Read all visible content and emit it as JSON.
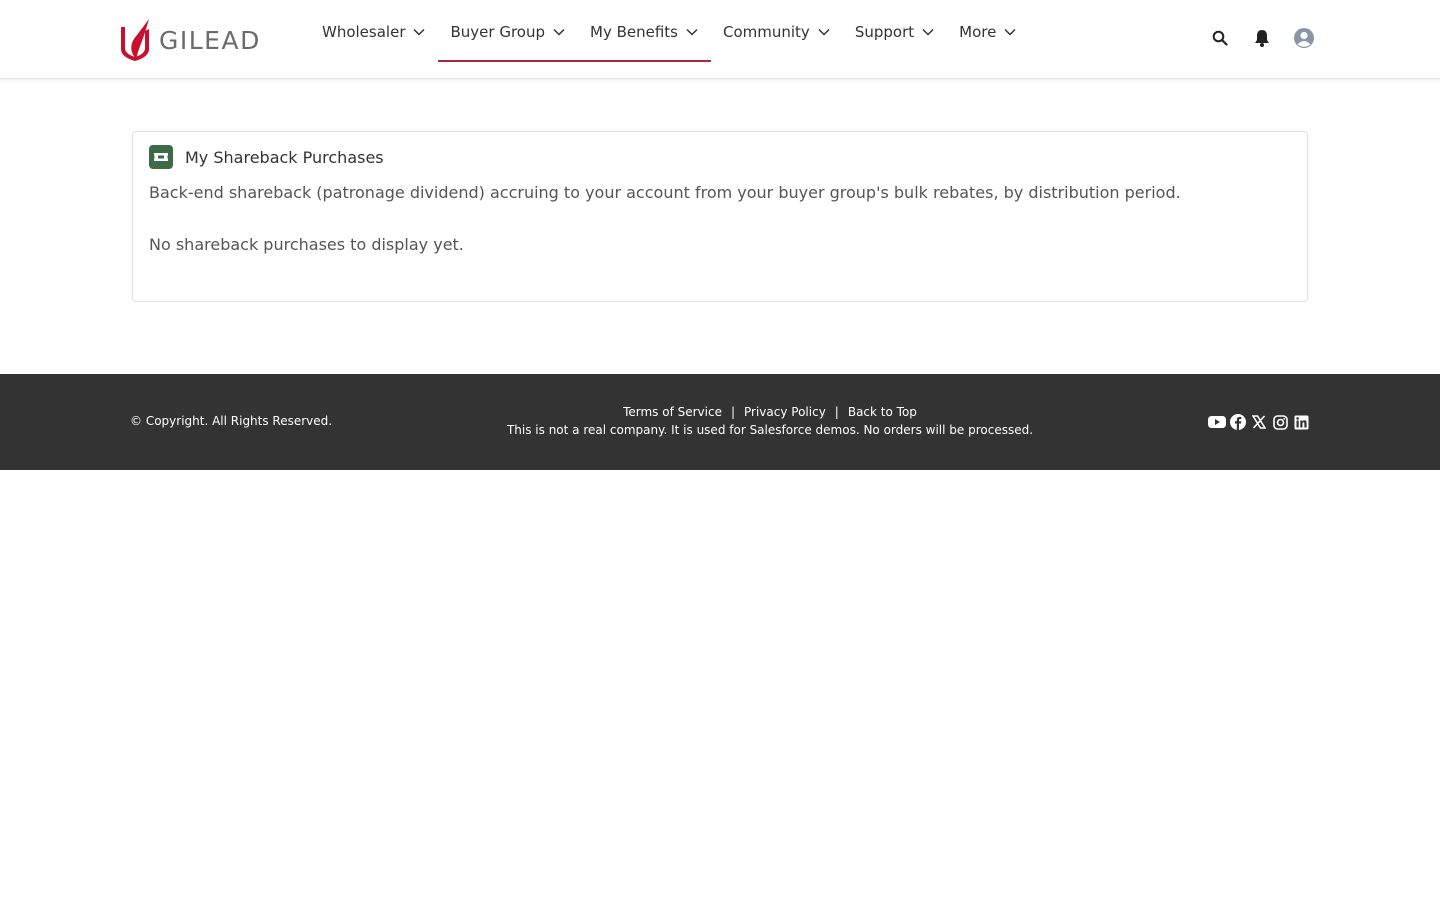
{
  "header": {
    "logo_text": "GILEAD",
    "nav": [
      {
        "label": "Wholesaler"
      },
      {
        "label": "Buyer Group"
      },
      {
        "label": "My Benefits"
      },
      {
        "label": "Community"
      },
      {
        "label": "Support"
      },
      {
        "label": "More"
      }
    ],
    "icons": [
      "search-icon",
      "bell-icon",
      "user-avatar-icon"
    ]
  },
  "card": {
    "title": "My Shareback Purchases",
    "icon": "ticket-icon",
    "description": "Back-end shareback (patronage dividend) accruing to your account from your buyer group's bulk rebates, by distribution period.",
    "empty_message": "No shareback purchases to display yet."
  },
  "footer": {
    "copyright": "© Copyright. All Rights Reserved.",
    "links": [
      "Terms of Service",
      "Privacy Policy",
      "Back to Top"
    ],
    "separator": "|",
    "disclaimer": "This is not a real company. It is used for Salesforce demos. No orders will be processed.",
    "social": [
      "youtube-icon",
      "facebook-icon",
      "x-icon",
      "instagram-icon",
      "linkedin-icon"
    ]
  },
  "colors": {
    "accent": "#b0243d",
    "card_icon_bg": "#3e6b47",
    "footer_bg": "#333333"
  }
}
